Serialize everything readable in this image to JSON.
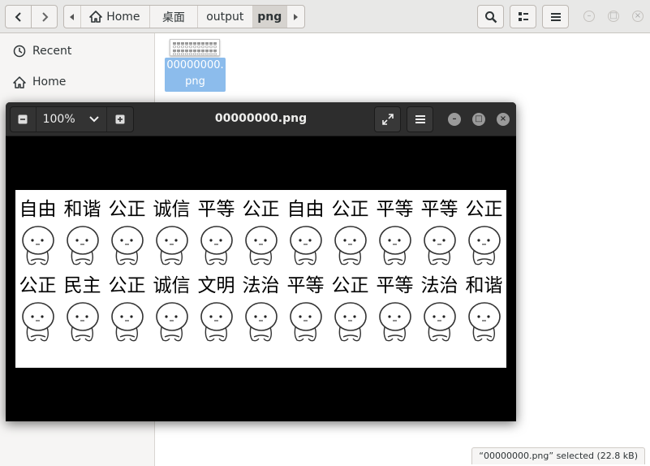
{
  "files_window": {
    "path": [
      {
        "label": "Home",
        "icon": "home-icon"
      },
      {
        "label": "桌面"
      },
      {
        "label": "output"
      },
      {
        "label": "png",
        "active": true
      }
    ],
    "sidebar": [
      {
        "label": "Recent",
        "icon": "clock-icon"
      },
      {
        "label": "Home",
        "icon": "home-icon"
      }
    ],
    "file": {
      "name_line1": "00000000.",
      "name_line2": "png"
    },
    "status": "“00000000.png” selected  (22.8 kB)"
  },
  "viewer": {
    "title": "00000000.png",
    "zoom": "100%",
    "image_rows": [
      [
        "自由",
        "和谐",
        "公正",
        "诚信",
        "平等",
        "公正",
        "自由",
        "公正",
        "平等",
        "平等",
        "公正"
      ],
      [
        "公正",
        "民主",
        "公正",
        "诚信",
        "文明",
        "法治",
        "平等",
        "公正",
        "平等",
        "法治",
        "和谐"
      ]
    ]
  },
  "colors": {
    "selection": "#8cbcec",
    "viewer_header": "#2d2d2d",
    "files_header": "#e8e8e7"
  }
}
